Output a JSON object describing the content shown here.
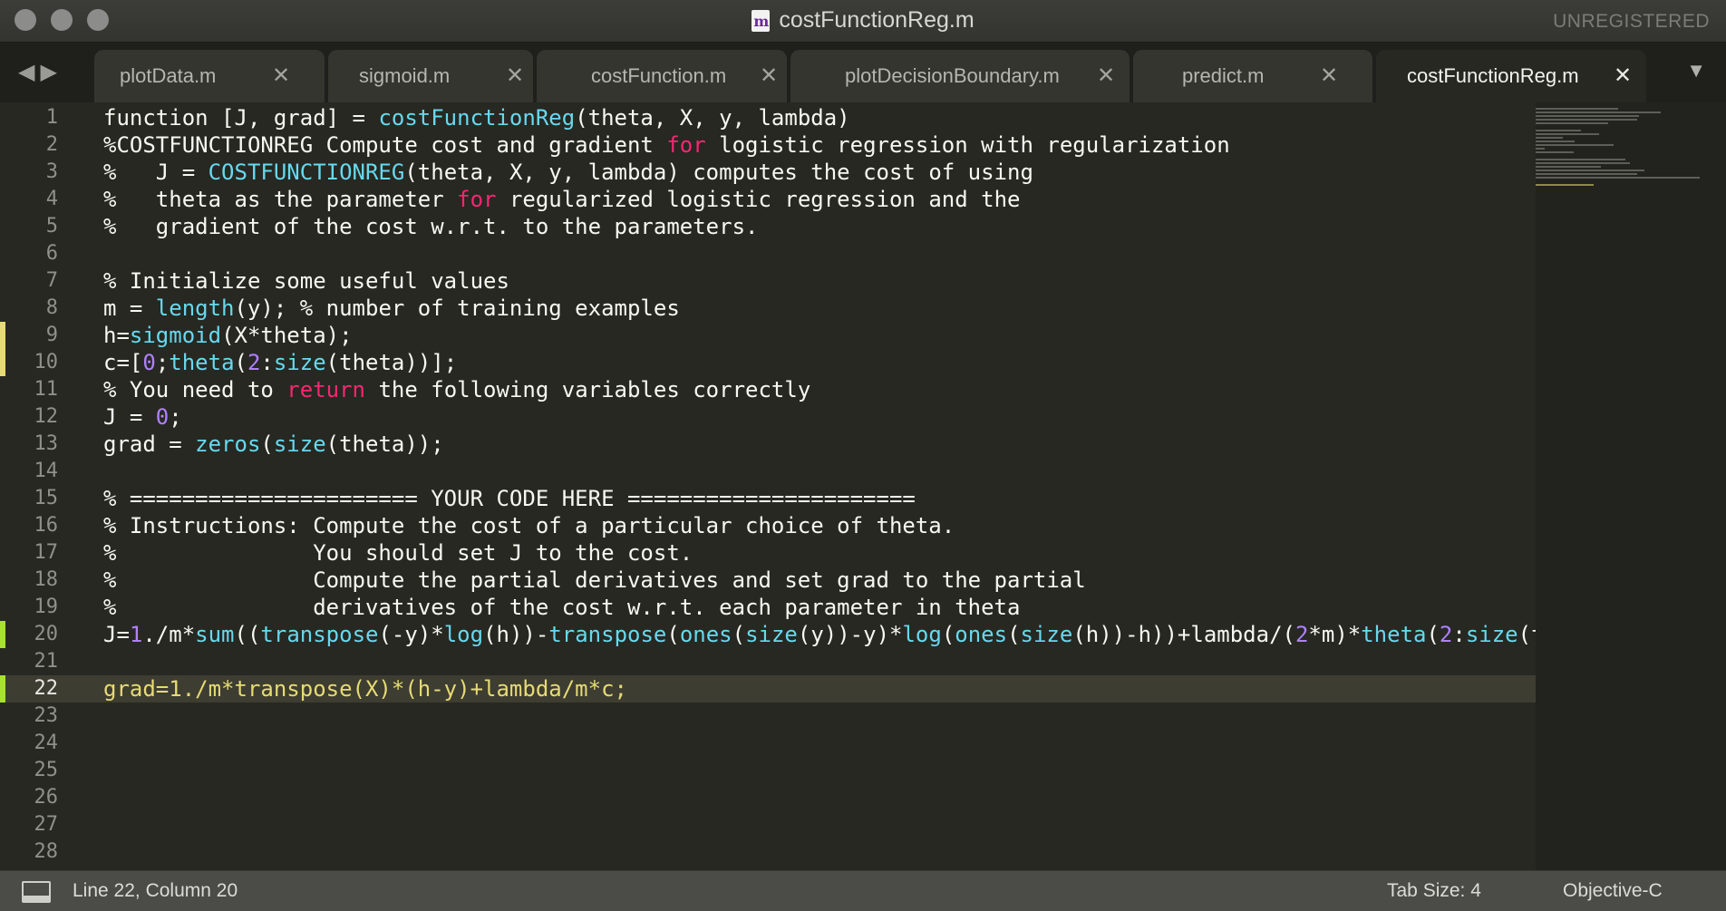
{
  "window": {
    "title": "costFunctionReg.m",
    "file_icon_letter": "m",
    "license": "UNREGISTERED"
  },
  "tabs": [
    {
      "label": "plotData.m",
      "close": "✕",
      "active": false
    },
    {
      "label": "sigmoid.m",
      "close": "✕",
      "active": false
    },
    {
      "label": "costFunction.m",
      "close": "✕",
      "active": false
    },
    {
      "label": "plotDecisionBoundary.m",
      "close": "✕",
      "active": false
    },
    {
      "label": "predict.m",
      "close": "✕",
      "active": false
    },
    {
      "label": "costFunctionReg.m",
      "close": "✕",
      "active": true
    }
  ],
  "nav": {
    "back": "◀",
    "forward": "▶",
    "tab_menu": "▼"
  },
  "line_numbers": [
    "1",
    "2",
    "3",
    "4",
    "5",
    "6",
    "7",
    "8",
    "9",
    "10",
    "11",
    "12",
    "13",
    "14",
    "15",
    "16",
    "17",
    "18",
    "19",
    "20",
    "21",
    "22",
    "23",
    "24",
    "25",
    "26",
    "27",
    "28"
  ],
  "current_line": 22,
  "modified_lines": [
    {
      "line": 9,
      "color": "#e6db74"
    },
    {
      "line": 10,
      "color": "#e6db74"
    },
    {
      "line": 20,
      "color": "#a6e22e"
    },
    {
      "line": 22,
      "color": "#a6e22e"
    }
  ],
  "code_lines": [
    [
      {
        "t": "function [J, grad] = "
      },
      {
        "t": "costFunctionReg",
        "c": "fn"
      },
      {
        "t": "(theta, X, y, lambda)"
      }
    ],
    [
      {
        "t": "%COSTFUNCTIONREG Compute cost and gradient "
      },
      {
        "t": "for",
        "c": "kw"
      },
      {
        "t": " logistic regression with regularization"
      }
    ],
    [
      {
        "t": "%   J = "
      },
      {
        "t": "COSTFUNCTIONREG",
        "c": "fn"
      },
      {
        "t": "(theta, X, y, lambda) computes the cost of using"
      }
    ],
    [
      {
        "t": "%   theta as the parameter "
      },
      {
        "t": "for",
        "c": "kw"
      },
      {
        "t": " regularized logistic regression and the"
      }
    ],
    [
      {
        "t": "%   gradient of the cost w.r.t. to the parameters."
      }
    ],
    [],
    [
      {
        "t": "% Initialize some useful values"
      }
    ],
    [
      {
        "t": "m = "
      },
      {
        "t": "length",
        "c": "fn"
      },
      {
        "t": "(y); % number of training examples"
      }
    ],
    [
      {
        "t": "h="
      },
      {
        "t": "sigmoid",
        "c": "fn"
      },
      {
        "t": "(X*theta);"
      }
    ],
    [
      {
        "t": "c=["
      },
      {
        "t": "0",
        "c": "num"
      },
      {
        "t": ";"
      },
      {
        "t": "theta",
        "c": "fn"
      },
      {
        "t": "("
      },
      {
        "t": "2",
        "c": "num"
      },
      {
        "t": ":"
      },
      {
        "t": "size",
        "c": "fn"
      },
      {
        "t": "(theta))];"
      }
    ],
    [
      {
        "t": "% You need to "
      },
      {
        "t": "return",
        "c": "kw"
      },
      {
        "t": " the following variables correctly"
      }
    ],
    [
      {
        "t": "J = "
      },
      {
        "t": "0",
        "c": "num"
      },
      {
        "t": ";"
      }
    ],
    [
      {
        "t": "grad = "
      },
      {
        "t": "zeros",
        "c": "fn"
      },
      {
        "t": "("
      },
      {
        "t": "size",
        "c": "fn"
      },
      {
        "t": "(theta));"
      }
    ],
    [],
    [
      {
        "t": "% ====================== YOUR CODE HERE ======================"
      }
    ],
    [
      {
        "t": "% Instructions: Compute the cost of a particular choice of theta."
      }
    ],
    [
      {
        "t": "%               You should set J to the cost."
      }
    ],
    [
      {
        "t": "%               Compute the partial derivatives and set grad to the partial"
      }
    ],
    [
      {
        "t": "%               derivatives of the cost w.r.t. each parameter in theta"
      }
    ],
    [
      {
        "t": "J="
      },
      {
        "t": "1",
        "c": "num"
      },
      {
        "t": "./m*"
      },
      {
        "t": "sum",
        "c": "fn"
      },
      {
        "t": "(("
      },
      {
        "t": "transpose",
        "c": "fn"
      },
      {
        "t": "(-y)*"
      },
      {
        "t": "log",
        "c": "fn"
      },
      {
        "t": "(h))-"
      },
      {
        "t": "transpose",
        "c": "fn"
      },
      {
        "t": "("
      },
      {
        "t": "ones",
        "c": "fn"
      },
      {
        "t": "("
      },
      {
        "t": "size",
        "c": "fn"
      },
      {
        "t": "(y))-y)*"
      },
      {
        "t": "log",
        "c": "fn"
      },
      {
        "t": "("
      },
      {
        "t": "ones",
        "c": "fn"
      },
      {
        "t": "("
      },
      {
        "t": "size",
        "c": "fn"
      },
      {
        "t": "(h))-h))+lambda/("
      },
      {
        "t": "2",
        "c": "num"
      },
      {
        "t": "*m)*"
      },
      {
        "t": "theta",
        "c": "fn"
      },
      {
        "t": "("
      },
      {
        "t": "2",
        "c": "num"
      },
      {
        "t": ":"
      },
      {
        "t": "size",
        "c": "fn"
      },
      {
        "t": "(thet"
      }
    ],
    [],
    [
      {
        "t": "grad=1./m*transpose(X)*(h-y)+lambda/m*c;",
        "c": "str"
      }
    ],
    [],
    [],
    [],
    [],
    [],
    []
  ],
  "status": {
    "position": "Line 22, Column 20",
    "tab_size": "Tab Size: 4",
    "syntax": "Objective-C"
  }
}
